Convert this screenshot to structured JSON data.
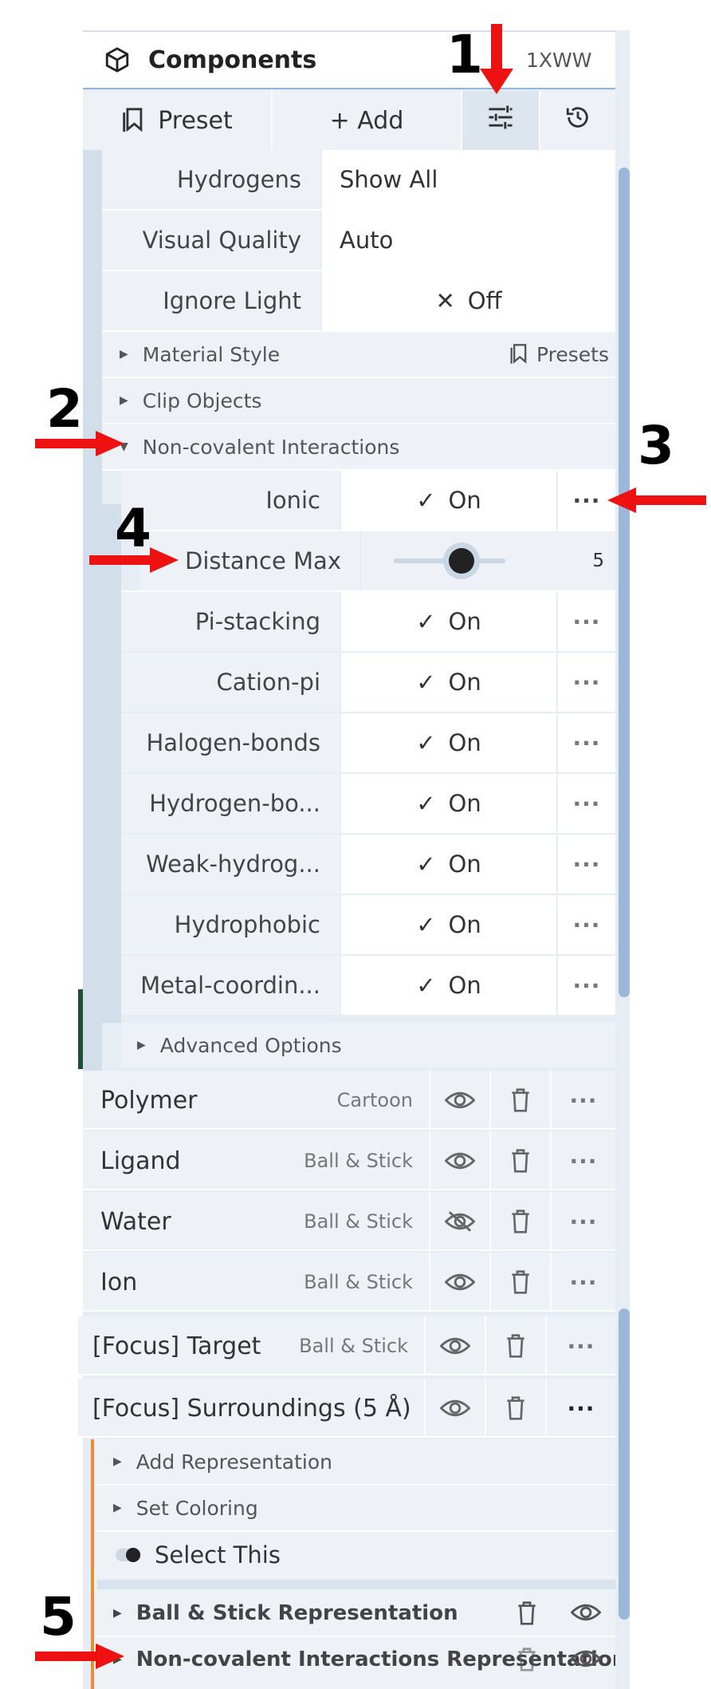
{
  "header": {
    "title": "Components",
    "structure_id": "1XWW"
  },
  "toolbar": {
    "preset_label": "Preset",
    "add_label": "+ Add"
  },
  "options": {
    "hydrogens": {
      "label": "Hydrogens",
      "value": "Show All"
    },
    "visual_quality": {
      "label": "Visual Quality",
      "value": "Auto"
    },
    "ignore_light": {
      "label": "Ignore Light",
      "value": "Off"
    },
    "material_style": {
      "label": "Material Style",
      "presets_label": "Presets"
    },
    "clip_objects": {
      "label": "Clip Objects"
    },
    "non_covalent": {
      "label": "Non-covalent Interactions"
    }
  },
  "interactions": [
    {
      "label": "Ionic",
      "value": "On"
    },
    {
      "label": "Pi-stacking",
      "value": "On"
    },
    {
      "label": "Cation-pi",
      "value": "On"
    },
    {
      "label": "Halogen-bonds",
      "value": "On"
    },
    {
      "label": "Hydrogen-bo...",
      "value": "On"
    },
    {
      "label": "Weak-hydrog...",
      "value": "On"
    },
    {
      "label": "Hydrophobic",
      "value": "On"
    },
    {
      "label": "Metal-coordin...",
      "value": "On"
    }
  ],
  "distance_max": {
    "label": "Distance Max",
    "value": "5",
    "fraction": 0.61
  },
  "advanced_options": {
    "label": "Advanced Options"
  },
  "components": [
    {
      "name": "Polymer",
      "type": "Cartoon",
      "visible": true
    },
    {
      "name": "Ligand",
      "type": "Ball & Stick",
      "visible": true
    },
    {
      "name": "Water",
      "type": "Ball & Stick",
      "visible": false
    },
    {
      "name": "Ion",
      "type": "Ball & Stick",
      "visible": true
    },
    {
      "name": "[Focus] Target",
      "type": "Ball & Stick",
      "visible": true
    },
    {
      "name": "[Focus] Surroundings (5 Å)",
      "type": "",
      "visible": true
    }
  ],
  "surroundings_menu": {
    "add_representation": "Add Representation",
    "set_coloring": "Set Coloring",
    "select_this": "Select This",
    "ball_stick_rep": "Ball & Stick Representation",
    "nci_rep": "Non-covalent Interactions Representation"
  },
  "annotations": {
    "m1": "1",
    "m2": "2",
    "m3": "3",
    "m4": "4",
    "m5": "5"
  },
  "colors": {
    "arrow": "#ee1111",
    "accent_bar": "#e8902f",
    "header_underline": "#8eb4dc"
  }
}
